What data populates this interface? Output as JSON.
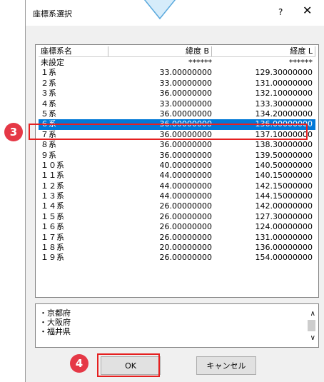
{
  "dialog": {
    "title": "座標系選択",
    "help_label": "?",
    "close_label": "✕"
  },
  "table": {
    "headers": [
      "座標系名",
      "緯度 B",
      "経度 L"
    ],
    "rows": [
      [
        "未設定",
        "******",
        "******"
      ],
      [
        "１系",
        "33.00000000",
        "129.30000000"
      ],
      [
        "２系",
        "33.00000000",
        "131.00000000"
      ],
      [
        "３系",
        "36.00000000",
        "132.10000000"
      ],
      [
        "４系",
        "33.00000000",
        "133.30000000"
      ],
      [
        "５系",
        "36.00000000",
        "134.20000000"
      ],
      [
        "６系",
        "36.00000000",
        "136.00000000"
      ],
      [
        "７系",
        "36.00000000",
        "137.10000000"
      ],
      [
        "８系",
        "36.00000000",
        "138.30000000"
      ],
      [
        "９系",
        "36.00000000",
        "139.50000000"
      ],
      [
        "１０系",
        "40.00000000",
        "140.50000000"
      ],
      [
        "１１系",
        "44.00000000",
        "140.15000000"
      ],
      [
        "１２系",
        "44.00000000",
        "142.15000000"
      ],
      [
        "１３系",
        "44.00000000",
        "144.15000000"
      ],
      [
        "１４系",
        "26.00000000",
        "142.00000000"
      ],
      [
        "１５系",
        "26.00000000",
        "127.30000000"
      ],
      [
        "１６系",
        "26.00000000",
        "124.00000000"
      ],
      [
        "１７系",
        "26.00000000",
        "131.00000000"
      ],
      [
        "１８系",
        "20.00000000",
        "136.00000000"
      ],
      [
        "１９系",
        "26.00000000",
        "154.00000000"
      ]
    ],
    "selected_index": 6
  },
  "prefectures": [
    "・京都府",
    "・大阪府",
    "・福井県"
  ],
  "buttons": {
    "ok": "OK",
    "cancel": "キャンセル"
  },
  "markers": {
    "step3": "3",
    "step4": "4"
  },
  "colors": {
    "selection": "#0078d7",
    "marker": "#e53846",
    "callout_border": "#e52020"
  },
  "icons": {
    "pointer": "pointer-triangle-icon",
    "scroll_up": "chevron-up-icon",
    "scroll_down": "chevron-down-icon"
  }
}
